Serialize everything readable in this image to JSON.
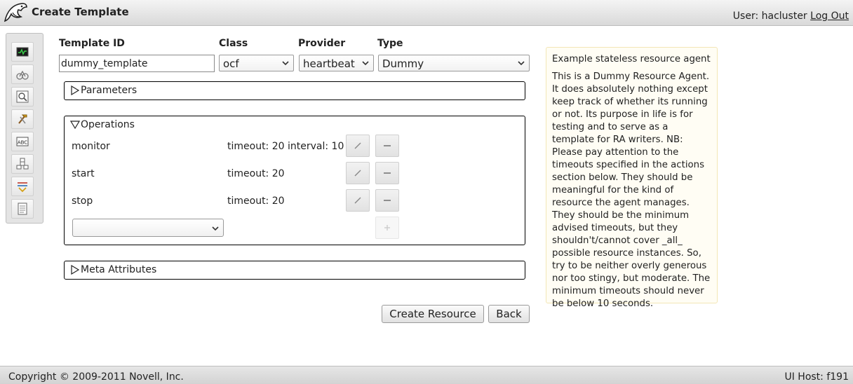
{
  "header": {
    "title": "Create Template",
    "user_label": "User: hacluster",
    "logout_label": "Log Out"
  },
  "sidebar": {
    "items": [
      {
        "icon": "monitor-icon"
      },
      {
        "icon": "nodes-icon"
      },
      {
        "icon": "search-icon"
      },
      {
        "icon": "tools-icon"
      },
      {
        "icon": "abc-icon"
      },
      {
        "icon": "resources-icon"
      },
      {
        "icon": "filter-icon"
      },
      {
        "icon": "document-icon"
      }
    ]
  },
  "form": {
    "template_id_label": "Template ID",
    "template_id_value": "dummy_template",
    "class_label": "Class",
    "class_value": "ocf",
    "provider_label": "Provider",
    "provider_value": "heartbeat",
    "type_label": "Type",
    "type_value": "Dummy"
  },
  "sections": {
    "parameters": "Parameters",
    "operations": "Operations",
    "meta_attributes": "Meta Attributes"
  },
  "operations": [
    {
      "name": "monitor",
      "detail": "timeout: 20 interval: 10"
    },
    {
      "name": "start",
      "detail": "timeout: 20"
    },
    {
      "name": "stop",
      "detail": "timeout: 20"
    }
  ],
  "buttons": {
    "create": "Create Resource",
    "back": "Back"
  },
  "help": {
    "title": "Example stateless resource agent",
    "body": "This is a Dummy Resource Agent. It does absolutely nothing except keep track of whether its running or not. Its purpose in life is for testing and to serve as a template for RA writers. NB: Please pay attention to the timeouts specified in the actions section below. They should be meaningful for the kind of resource the agent manages. They should be the minimum advised timeouts, but they shouldn't/cannot cover _all_ possible resource instances. So, try to be neither overly generous nor too stingy, but moderate. The minimum timeouts should never be below 10 seconds."
  },
  "footer": {
    "copyright": "Copyright © 2009-2011 Novell, Inc.",
    "host": "UI Host: f191"
  },
  "colors": {
    "help_bg": "#fffdf4",
    "help_border": "#f3e6b5",
    "header_bg": "#e0e0e0"
  }
}
